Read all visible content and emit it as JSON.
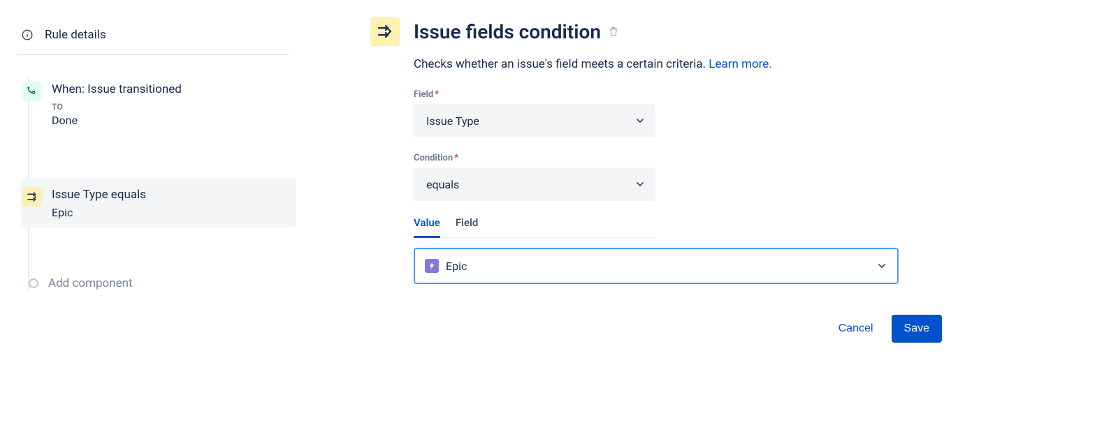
{
  "sidebar": {
    "rule_details_label": "Rule details",
    "trigger": {
      "title": "When: Issue transitioned",
      "sub_label": "TO",
      "sub_value": "Done"
    },
    "condition": {
      "title": "Issue Type equals",
      "sub_value": "Epic"
    },
    "add_component": "Add component"
  },
  "main": {
    "title": "Issue fields condition",
    "description": "Checks whether an issue's field meets a certain criteria. ",
    "learn_more": "Learn more.",
    "field_label": "Field",
    "field_value": "Issue Type",
    "condition_label": "Condition",
    "condition_value": "equals",
    "tabs": {
      "value": "Value",
      "field": "Field"
    },
    "value_selected": "Epic",
    "cancel": "Cancel",
    "save": "Save"
  }
}
